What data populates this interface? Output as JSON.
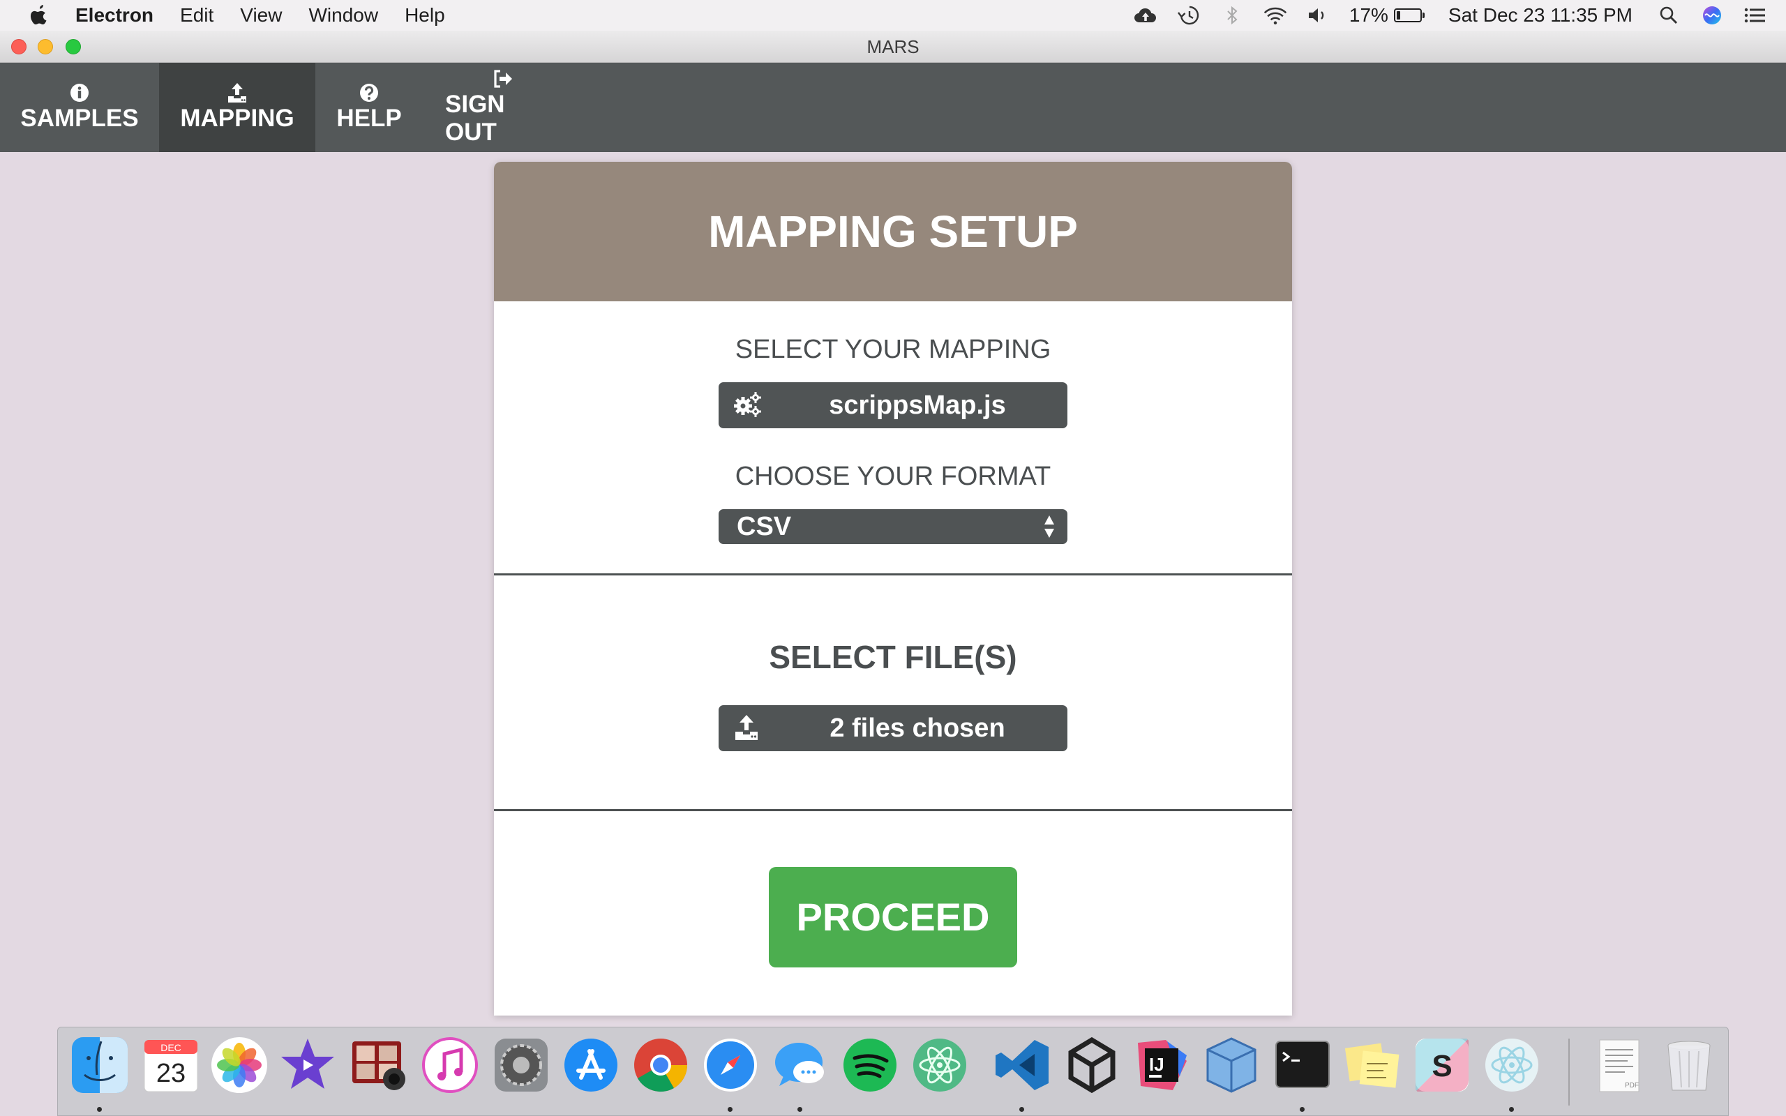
{
  "menubar": {
    "app_name": "Electron",
    "menus": [
      "Edit",
      "View",
      "Window",
      "Help"
    ],
    "battery_percent": "17%",
    "battery_level": 0.17,
    "datetime": "Sat Dec 23  11:35 PM",
    "icons": [
      "apple-icon",
      "cloud-upload-icon",
      "time-machine-icon",
      "bluetooth-icon",
      "wifi-icon",
      "volume-icon",
      "battery-icon",
      "spotlight-search-icon",
      "siri-icon",
      "notification-center-icon"
    ]
  },
  "window": {
    "title": "MARS"
  },
  "nav": {
    "items": [
      {
        "label": "SAMPLES",
        "icon": "info-icon",
        "active": false
      },
      {
        "label": "MAPPING",
        "icon": "upload-icon",
        "active": true
      },
      {
        "label": "HELP",
        "icon": "question-icon",
        "active": false
      },
      {
        "label": "SIGN OUT",
        "icon": "sign-out-icon",
        "active": false
      }
    ]
  },
  "card": {
    "title": "MAPPING SETUP",
    "mapping_label": "SELECT YOUR MAPPING",
    "mapping_value": "scrippsMap.js",
    "format_label": "CHOOSE YOUR FORMAT",
    "format_value": "CSV",
    "files_label": "SELECT FILE(S)",
    "files_value": "2 files chosen",
    "proceed_label": "PROCEED"
  },
  "colors": {
    "nav_bg": "#545859",
    "nav_active": "#3f4242",
    "header_bg": "#96887c",
    "control_bg": "#505455",
    "proceed_bg": "#4cae4f",
    "page_bg": "#e3d9e2"
  },
  "dock": {
    "calendar_month": "DEC",
    "calendar_day": "23",
    "apps": [
      "finder-icon",
      "calendar-icon",
      "photos-icon",
      "imovie-icon",
      "photo-booth-icon",
      "itunes-icon",
      "system-preferences-icon",
      "app-store-icon",
      "chrome-icon",
      "safari-icon",
      "messages-icon",
      "spotify-icon",
      "atom-icon",
      "vscode-icon",
      "unity-icon",
      "intellij-icon",
      "virtualbox-icon",
      "terminal-icon",
      "stickies-icon",
      "slack-icon",
      "electron-icon",
      "pdf-document-icon",
      "trash-icon"
    ]
  }
}
